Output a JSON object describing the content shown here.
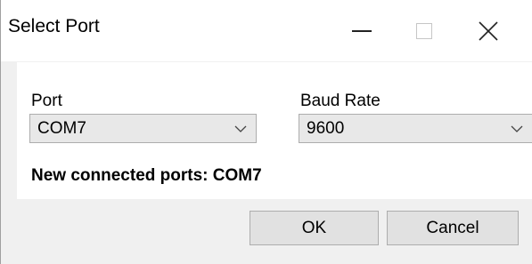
{
  "window": {
    "title": "Select Port",
    "controls": {
      "minimize_icon": "minimize-icon",
      "maximize_icon": "maximize-icon",
      "close_icon": "close-icon"
    }
  },
  "form": {
    "port": {
      "label": "Port",
      "selected": "COM7"
    },
    "baud_rate": {
      "label": "Baud Rate",
      "selected": "9600"
    },
    "status": {
      "prefix": "New connected ports: ",
      "ports": "COM7"
    }
  },
  "buttons": {
    "ok_label": "OK",
    "cancel_label": "Cancel"
  },
  "colors": {
    "dialog_background": "#f0f0f0",
    "panel_background": "#ffffff",
    "combo_background": "#e8e8e8",
    "button_background": "#e1e1e1",
    "border": "#adadad"
  }
}
